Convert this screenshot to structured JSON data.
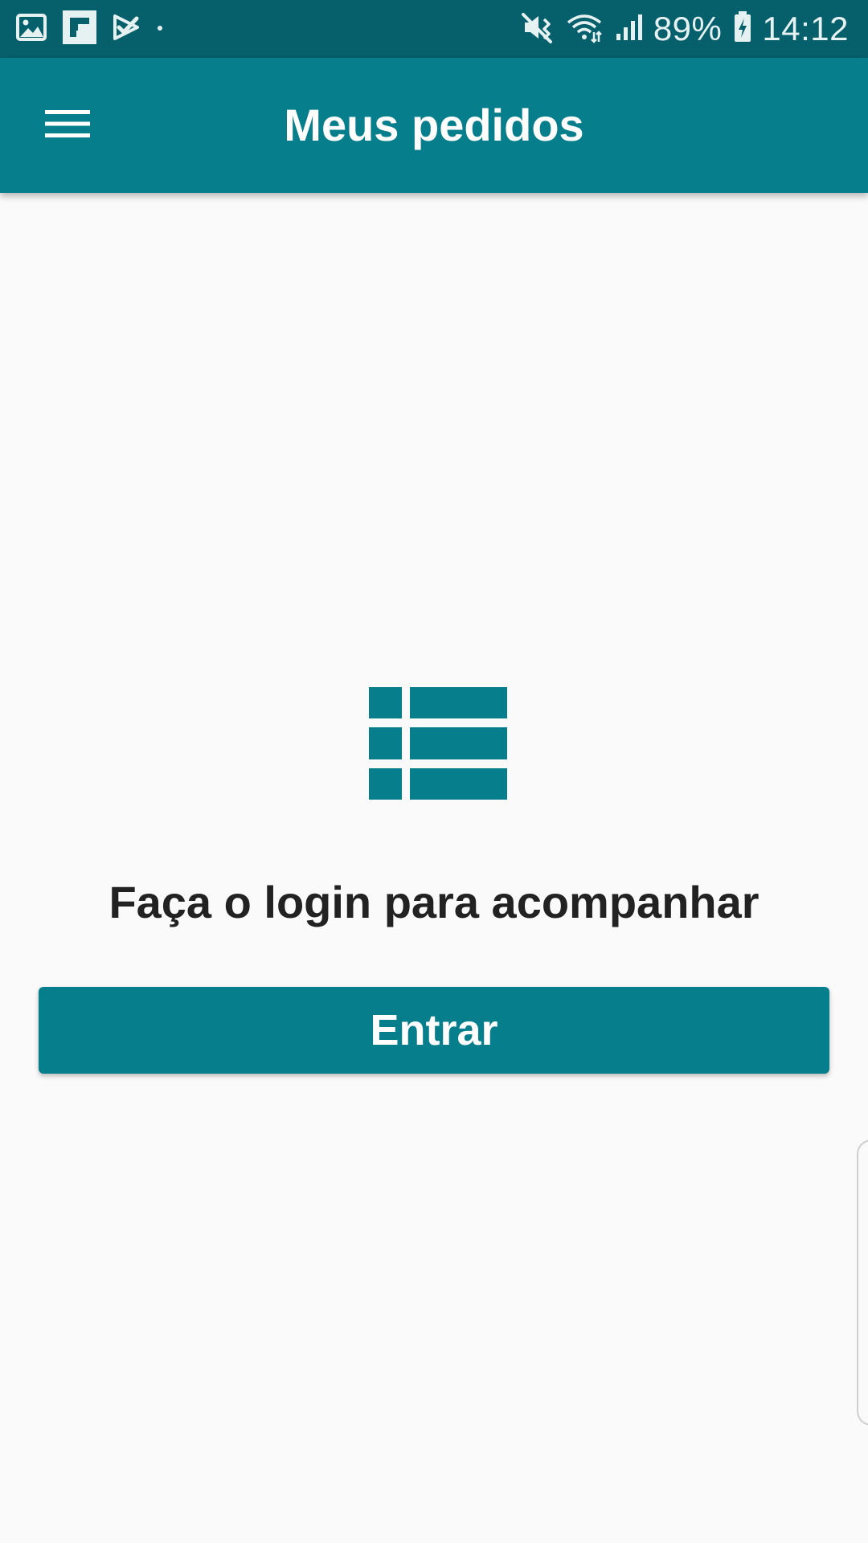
{
  "status_bar": {
    "left_icons": [
      "gallery-icon",
      "flipboard-icon",
      "check-notification-icon",
      "dot-icon"
    ],
    "right_icons": [
      "vibrate-mute-icon",
      "wifi-icon",
      "signal-icon",
      "battery-charging-icon"
    ],
    "battery": "89%",
    "time": "14:12"
  },
  "app_bar": {
    "title": "Meus pedidos",
    "menu_icon": "menu-icon"
  },
  "empty_state": {
    "icon": "list-icon",
    "message": "Faça o login para acompanhar",
    "button_label": "Entrar"
  },
  "colors": {
    "primary": "#077e8c",
    "status_bar": "#06606c",
    "background": "#fafafa",
    "text": "#222222"
  }
}
